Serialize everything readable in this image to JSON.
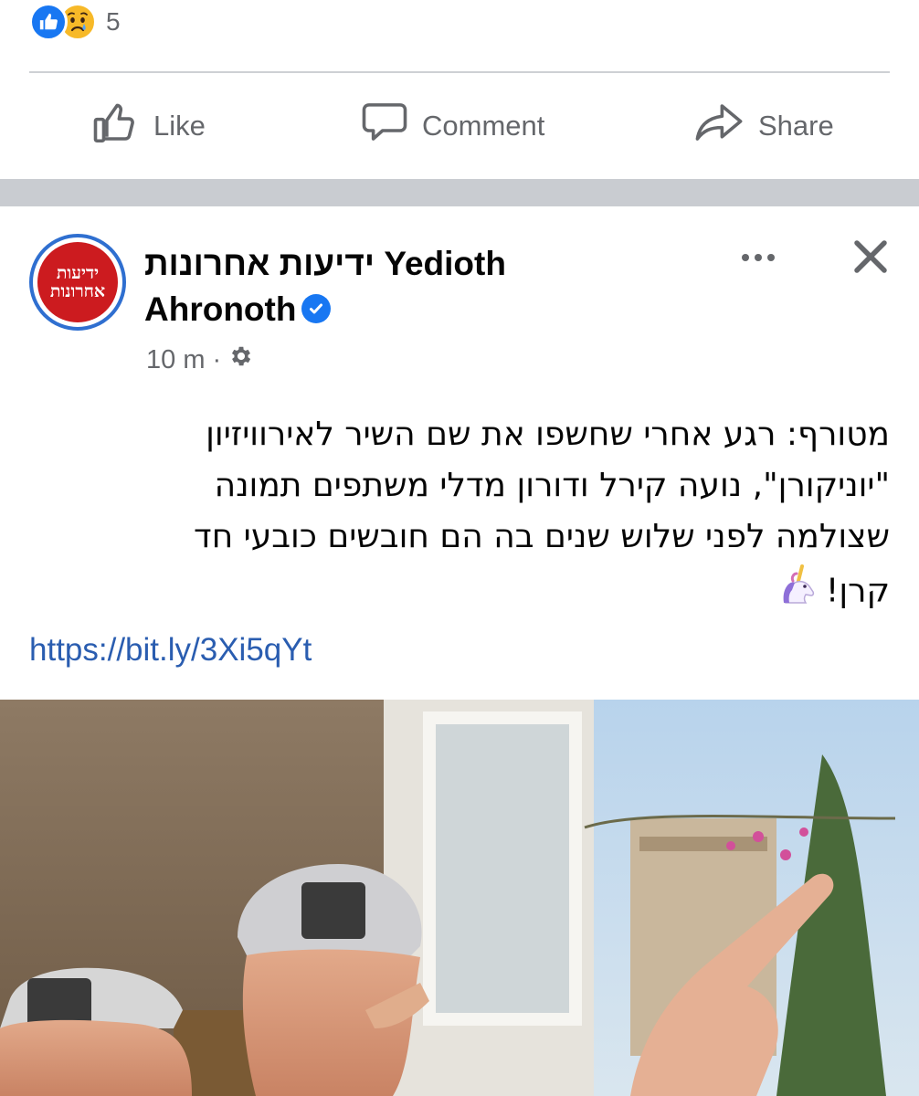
{
  "previous_post": {
    "reactions": {
      "icons": [
        "like-icon",
        "sad-icon"
      ],
      "count": "5"
    },
    "actions": {
      "like_label": "Like",
      "comment_label": "Comment",
      "share_label": "Share"
    }
  },
  "post": {
    "page_name": "ידיעות אחרונות Yedioth Ahronoth",
    "avatar_text_line1": "ידיעות",
    "avatar_text_line2": "אחרונות",
    "verified": true,
    "time": "10 m",
    "separator": "·",
    "audience_icon": "gear-icon",
    "text_lines": [
      "מטורף: רגע אחרי שחשפו את שם השיר לאירוויזיון",
      "\"יוניקורן\", נועה קירל ודורון מדלי משתפים תמונה",
      "שצולמה לפני שלוש שנים בה הם חובשים כובעי חד",
      "קרן!"
    ],
    "emoji": "unicorn",
    "link": "https://bit.ly/3Xi5qYt"
  },
  "colors": {
    "facebook_blue": "#1877f2",
    "secondary_text": "#65676b",
    "link": "#2a5db0",
    "logo_red": "#cc1b1f"
  }
}
